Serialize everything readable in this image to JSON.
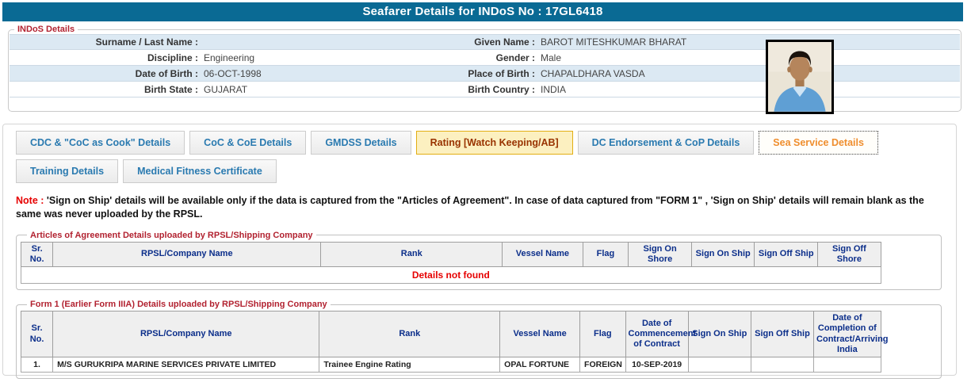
{
  "header": {
    "title": "Seafarer Details for INDoS No : 17GL6418"
  },
  "colors": {
    "title_bar_bg": "#0a6a94",
    "legend_maroon": "#b22230",
    "row_stripe_blue": "#dce9f3",
    "tab_text_blue": "#2a7ab0",
    "rating_tab_bg": "#fcf0c0",
    "rating_tab_border": "#e2ae14",
    "rating_tab_text": "#993300",
    "active_tab_text": "#ef8e2e",
    "note_red": "#e60000",
    "table_header_navy": "#0b2e8a",
    "not_found_red": "#e60000"
  },
  "indos": {
    "legend": "INDoS Details",
    "photo_icon": "seafarer-photo",
    "rows": [
      {
        "left_label": "Surname / Last Name :",
        "left_value": "",
        "right_label": "Given Name :",
        "right_value": "BAROT MITESHKUMAR BHARAT"
      },
      {
        "left_label": "Discipline :",
        "left_value": "Engineering",
        "right_label": "Gender :",
        "right_value": "Male"
      },
      {
        "left_label": "Date of Birth :",
        "left_value": "06-OCT-1998",
        "right_label": "Place of Birth :",
        "right_value": "CHAPALDHARA VASDA"
      },
      {
        "left_label": "Birth State :",
        "left_value": "GUJARAT",
        "right_label": "Birth Country :",
        "right_value": "INDIA"
      }
    ]
  },
  "tabs": {
    "items": [
      {
        "label": "CDC & \"CoC as Cook\" Details",
        "state": "normal"
      },
      {
        "label": "CoC & CoE Details",
        "state": "normal"
      },
      {
        "label": "GMDSS Details",
        "state": "normal"
      },
      {
        "label": "Rating [Watch Keeping/AB]",
        "state": "highlighted"
      },
      {
        "label": "DC Endorsement & CoP Details",
        "state": "normal"
      },
      {
        "label": "Sea Service Details",
        "state": "active"
      },
      {
        "label": "Training Details",
        "state": "normal"
      },
      {
        "label": "Medical Fitness Certificate",
        "state": "normal"
      }
    ]
  },
  "note": {
    "label": "Note :",
    "text": " 'Sign on Ship' details will be available only if the data is captured from the \"Articles of Agreement\". In case of data captured from \"FORM 1\" , 'Sign on Ship' details will remain blank as the same was never uploaded by the RPSL."
  },
  "aoa_table": {
    "legend": "Articles of Agreement Details uploaded by RPSL/Shipping Company",
    "columns": [
      "Sr. No.",
      "RPSL/Company Name",
      "Rank",
      "Vessel Name",
      "Flag",
      "Sign On Shore",
      "Sign On Ship",
      "Sign Off Ship",
      "Sign Off Shore"
    ],
    "empty_message": "Details not found"
  },
  "form1_table": {
    "legend": "Form 1 (Earlier Form IIIA) Details uploaded by RPSL/Shipping Company",
    "columns": [
      "Sr. No.",
      "RPSL/Company Name",
      "Rank",
      "Vessel Name",
      "Flag",
      "Date of Commencement of Contract",
      "Sign On Ship",
      "Sign Off Ship",
      "Date of Completion of Contract/Arriving India"
    ],
    "rows": [
      {
        "sr": "1.",
        "company": "M/S GURUKRIPA MARINE SERVICES PRIVATE LIMITED",
        "rank": "Trainee Engine Rating",
        "vessel": "OPAL FORTUNE",
        "flag": "FOREIGN",
        "date_commencement": "10-SEP-2019",
        "sign_on_ship": "",
        "sign_off_ship": "",
        "date_completion": ""
      }
    ]
  }
}
